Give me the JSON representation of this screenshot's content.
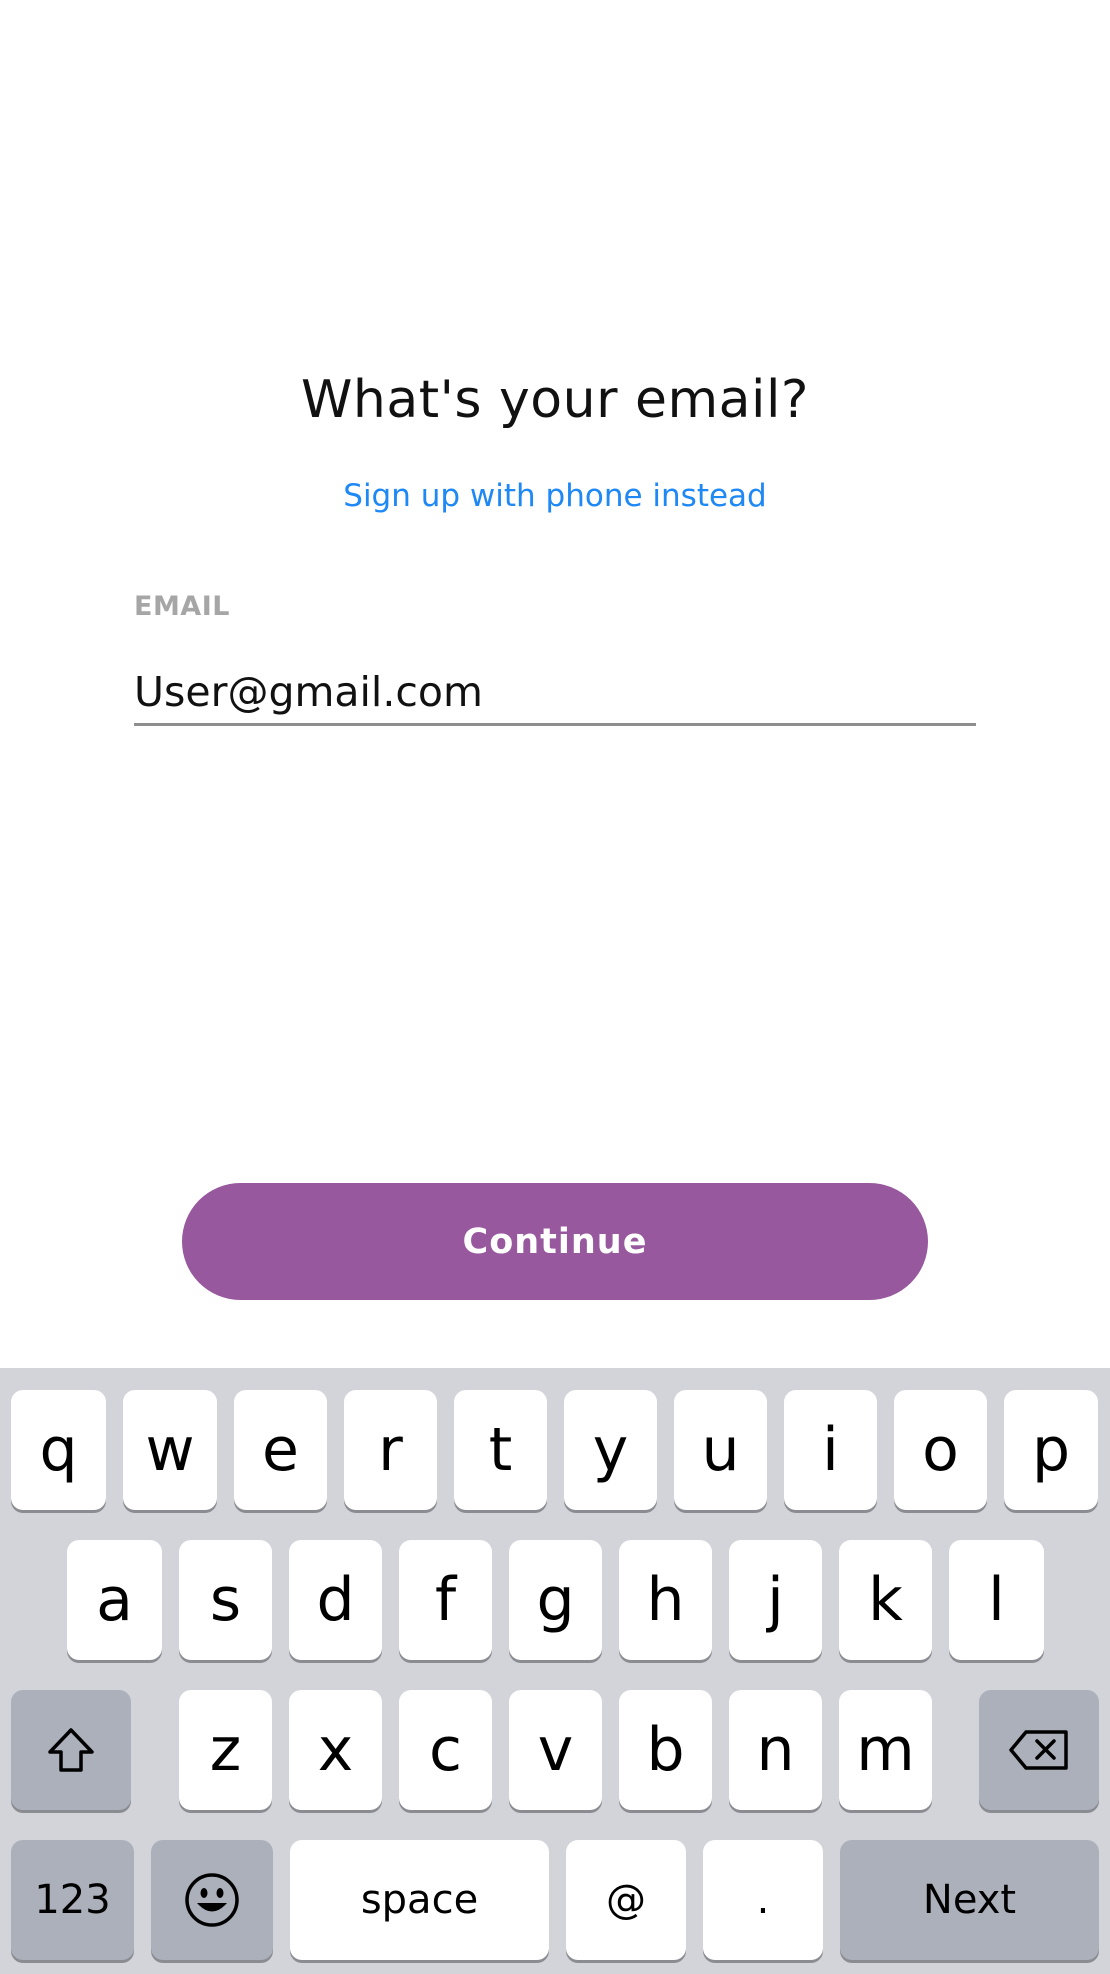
{
  "signup": {
    "title": "What's your email?",
    "alt_link": "Sign up with phone instead",
    "email_label": "EMAIL",
    "email_value": "User@gmail.com",
    "continue_label": "Continue",
    "accent_color": "#97589E",
    "link_color": "#1E88F5"
  },
  "keyboard": {
    "row1": [
      "q",
      "w",
      "e",
      "r",
      "t",
      "y",
      "u",
      "i",
      "o",
      "p"
    ],
    "row2": [
      "a",
      "s",
      "d",
      "f",
      "g",
      "h",
      "j",
      "k",
      "l"
    ],
    "row3": [
      "z",
      "x",
      "c",
      "v",
      "b",
      "n",
      "m"
    ],
    "shift_icon": "shift-arrow-icon",
    "delete_icon": "backspace-icon",
    "numbers_label": "123",
    "emoji_icon": "smiley-icon",
    "space_label": "space",
    "at_label": "@",
    "dot_label": ".",
    "next_label": "Next"
  }
}
